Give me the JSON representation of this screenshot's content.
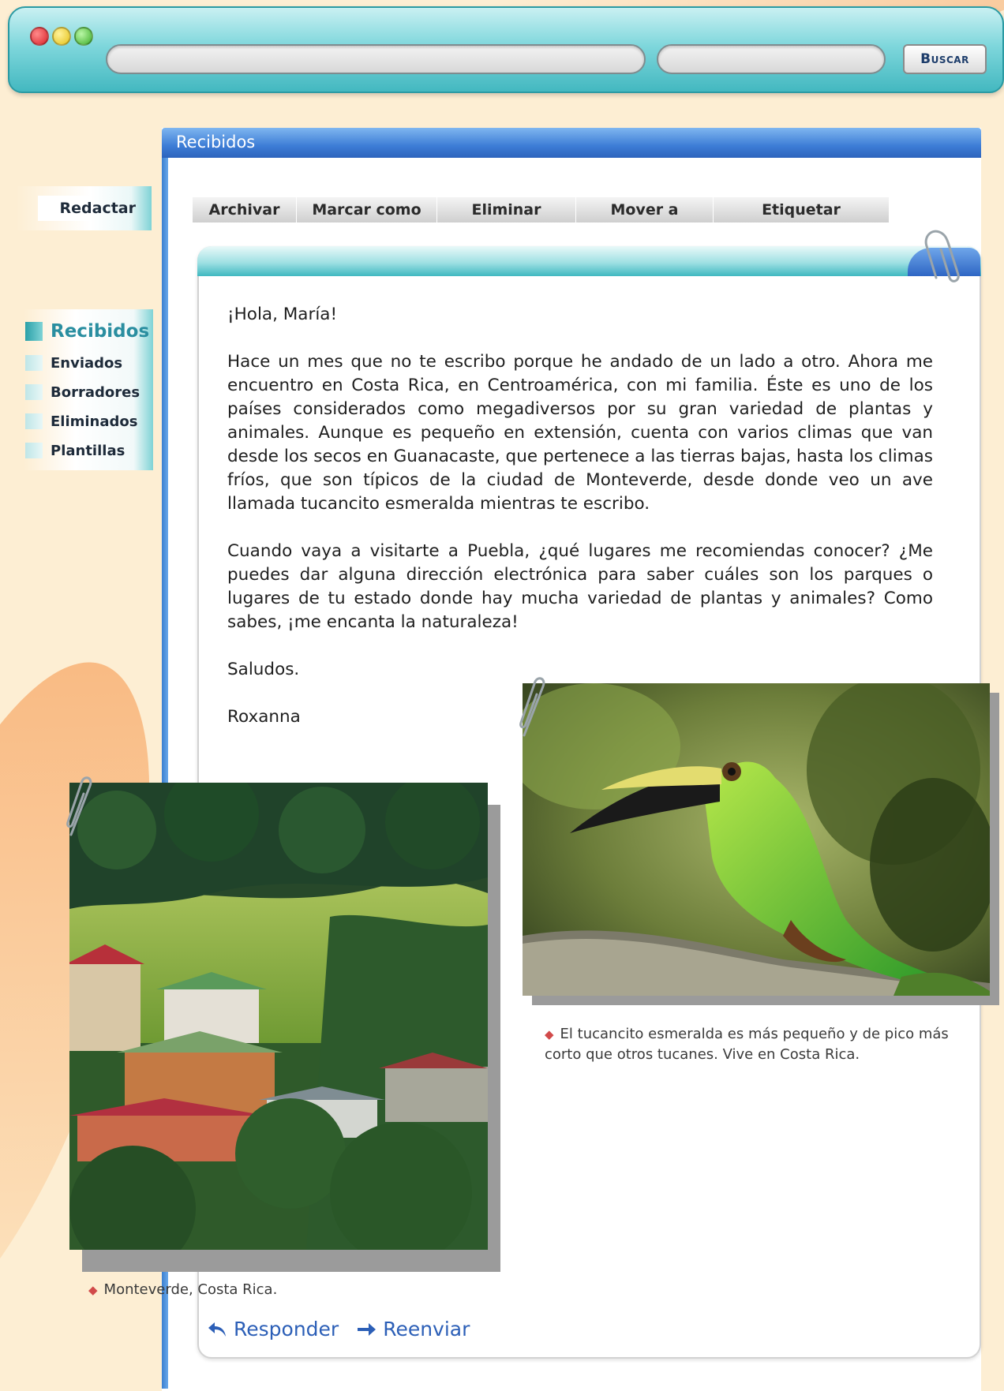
{
  "browser": {
    "search_button_label": "Buscar",
    "url_value": "",
    "search_value": ""
  },
  "sidebar": {
    "compose_label": "Redactar",
    "folders": [
      {
        "label": "Recibidos",
        "active": true
      },
      {
        "label": "Enviados"
      },
      {
        "label": "Borradores"
      },
      {
        "label": "Eliminados"
      },
      {
        "label": "Plantillas"
      }
    ]
  },
  "panel": {
    "title": "Recibidos"
  },
  "toolbar": {
    "buttons": [
      "Archivar",
      "Marcar como",
      "Eliminar",
      "Mover a",
      "Etiquetar"
    ]
  },
  "message": {
    "greeting": "¡Hola, María!",
    "paragraph1": "Hace un mes que no te escribo porque he andado de un lado a otro. Ahora me encuentro en Costa Rica, en Centroamérica, con mi familia. Éste es uno de los países considerados como megadiversos por su gran variedad de plantas y animales. Aunque es pequeño en extensión, cuenta con varios climas que van desde los secos en Guanacaste, que pertenece a las tierras bajas, hasta los climas fríos, que son típicos de la ciudad de Monteverde, desde donde veo un ave llamada tucancito esmeralda mientras te escribo.",
    "paragraph2": "Cuando vaya a visitarte a Puebla, ¿qué lugares me recomiendas conocer? ¿Me puedes dar alguna dirección electrónica para saber cuáles son los parques o lugares de tu estado donde hay mucha variedad de plantas y animales? Como sabes, ¡me encanta la naturaleza!",
    "closing": "Saludos.",
    "signature": "Roxanna"
  },
  "attachments": {
    "toucan_caption": "El tucancito esmeralda es más pequeño y de pico más corto que otros tucanes. Vive en Costa Rica.",
    "town_caption": "Monteverde, Costa Rica."
  },
  "actions": {
    "reply_label": "Responder",
    "forward_label": "Reenviar"
  },
  "colors": {
    "accent_teal": "#43b8c0",
    "accent_blue": "#3d7dd6",
    "link_blue": "#2c5fb7",
    "background": "#fdeed3"
  }
}
